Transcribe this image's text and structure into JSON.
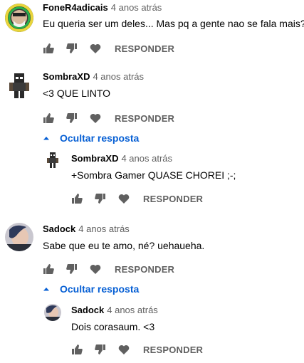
{
  "comments": [
    {
      "author": "FoneR4adicais",
      "time": "4 anos atrás",
      "text": "Eu queria ser um deles... Mas pq a gente nao se fala mais?",
      "reply_label": "RESPONDER"
    },
    {
      "author": "SombraXD",
      "time": "4 anos atrás",
      "text": "<3 QUE LINTO",
      "reply_label": "RESPONDER",
      "toggle_label": "Ocultar resposta",
      "replies": [
        {
          "author": "SombraXD",
          "time": "4 anos atrás",
          "text": "+Sombra Gamer QUASE CHOREI ;-;",
          "reply_label": "RESPONDER"
        }
      ]
    },
    {
      "author": "Sadock",
      "time": "4 anos atrás",
      "text": "Sabe que eu te amo, né? uehaueha.",
      "reply_label": "RESPONDER",
      "toggle_label": "Ocultar resposta",
      "replies": [
        {
          "author": "Sadock",
          "time": "4 anos atrás",
          "text": "Dois corasaum. <3",
          "reply_label": "RESPONDER"
        }
      ]
    }
  ],
  "icons": {
    "like": "thumbs-up-icon",
    "dislike": "thumbs-down-icon",
    "heart": "heart-icon",
    "toggle": "caret-up-icon"
  },
  "colors": {
    "link": "#065fd4",
    "icon": "#606060",
    "meta": "#606060"
  }
}
